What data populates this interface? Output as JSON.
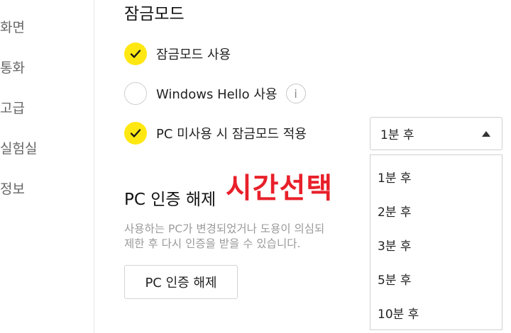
{
  "sidebar": {
    "items": [
      {
        "label": "화면"
      },
      {
        "label": "통화"
      },
      {
        "label": "고급"
      },
      {
        "label": "실험실"
      },
      {
        "label": "정보"
      }
    ]
  },
  "lock_mode": {
    "title": "잠금모드",
    "options": [
      {
        "label": "잠금모드 사용",
        "checked": true
      },
      {
        "label": "Windows Hello 사용",
        "checked": false,
        "icon": "info-icon",
        "icon_glyph": "i"
      },
      {
        "label": "PC 미사용 시 잠금모드 적용",
        "checked": true
      }
    ],
    "timeout_select": {
      "selected": "1분 후",
      "options": [
        "1분 후",
        "2분 후",
        "3분 후",
        "5분 후",
        "10분 후"
      ]
    }
  },
  "annotation": {
    "text": "시간선택",
    "color": "#e8202a"
  },
  "pc_auth": {
    "title": "PC 인증 해제",
    "description_lines": [
      "사용하는 PC가 변경되었거나 도용이 의심되",
      "제한 후 다시 인증을 받을 수 있습니다."
    ],
    "button_label": "PC 인증 해제"
  },
  "colors": {
    "accent": "#ffe812",
    "annotation": "#e8202a"
  }
}
